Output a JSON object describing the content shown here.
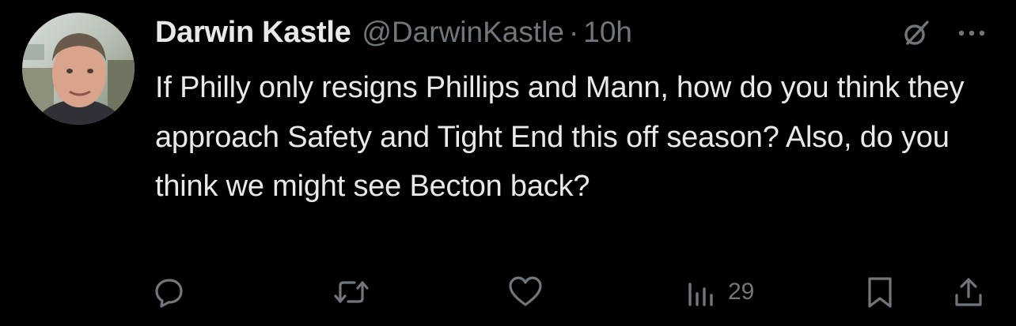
{
  "tweet": {
    "author": {
      "display_name": "Darwin Kastle",
      "handle": "@DarwinKastle",
      "separator": "·",
      "time": "10h"
    },
    "text": "If Philly only resigns Phillips and Mann, how do you think they approach Safety and Tight End this off season? Also, do you think we might see Becton back?",
    "actions": {
      "views_count": "29"
    }
  },
  "colors": {
    "background": "#000000",
    "text_primary": "#e7e9ea",
    "text_secondary": "#71767b"
  },
  "icons": [
    "grok-icon",
    "more-icon",
    "reply-icon",
    "retweet-icon",
    "like-icon",
    "views-icon",
    "bookmark-icon",
    "share-icon"
  ]
}
